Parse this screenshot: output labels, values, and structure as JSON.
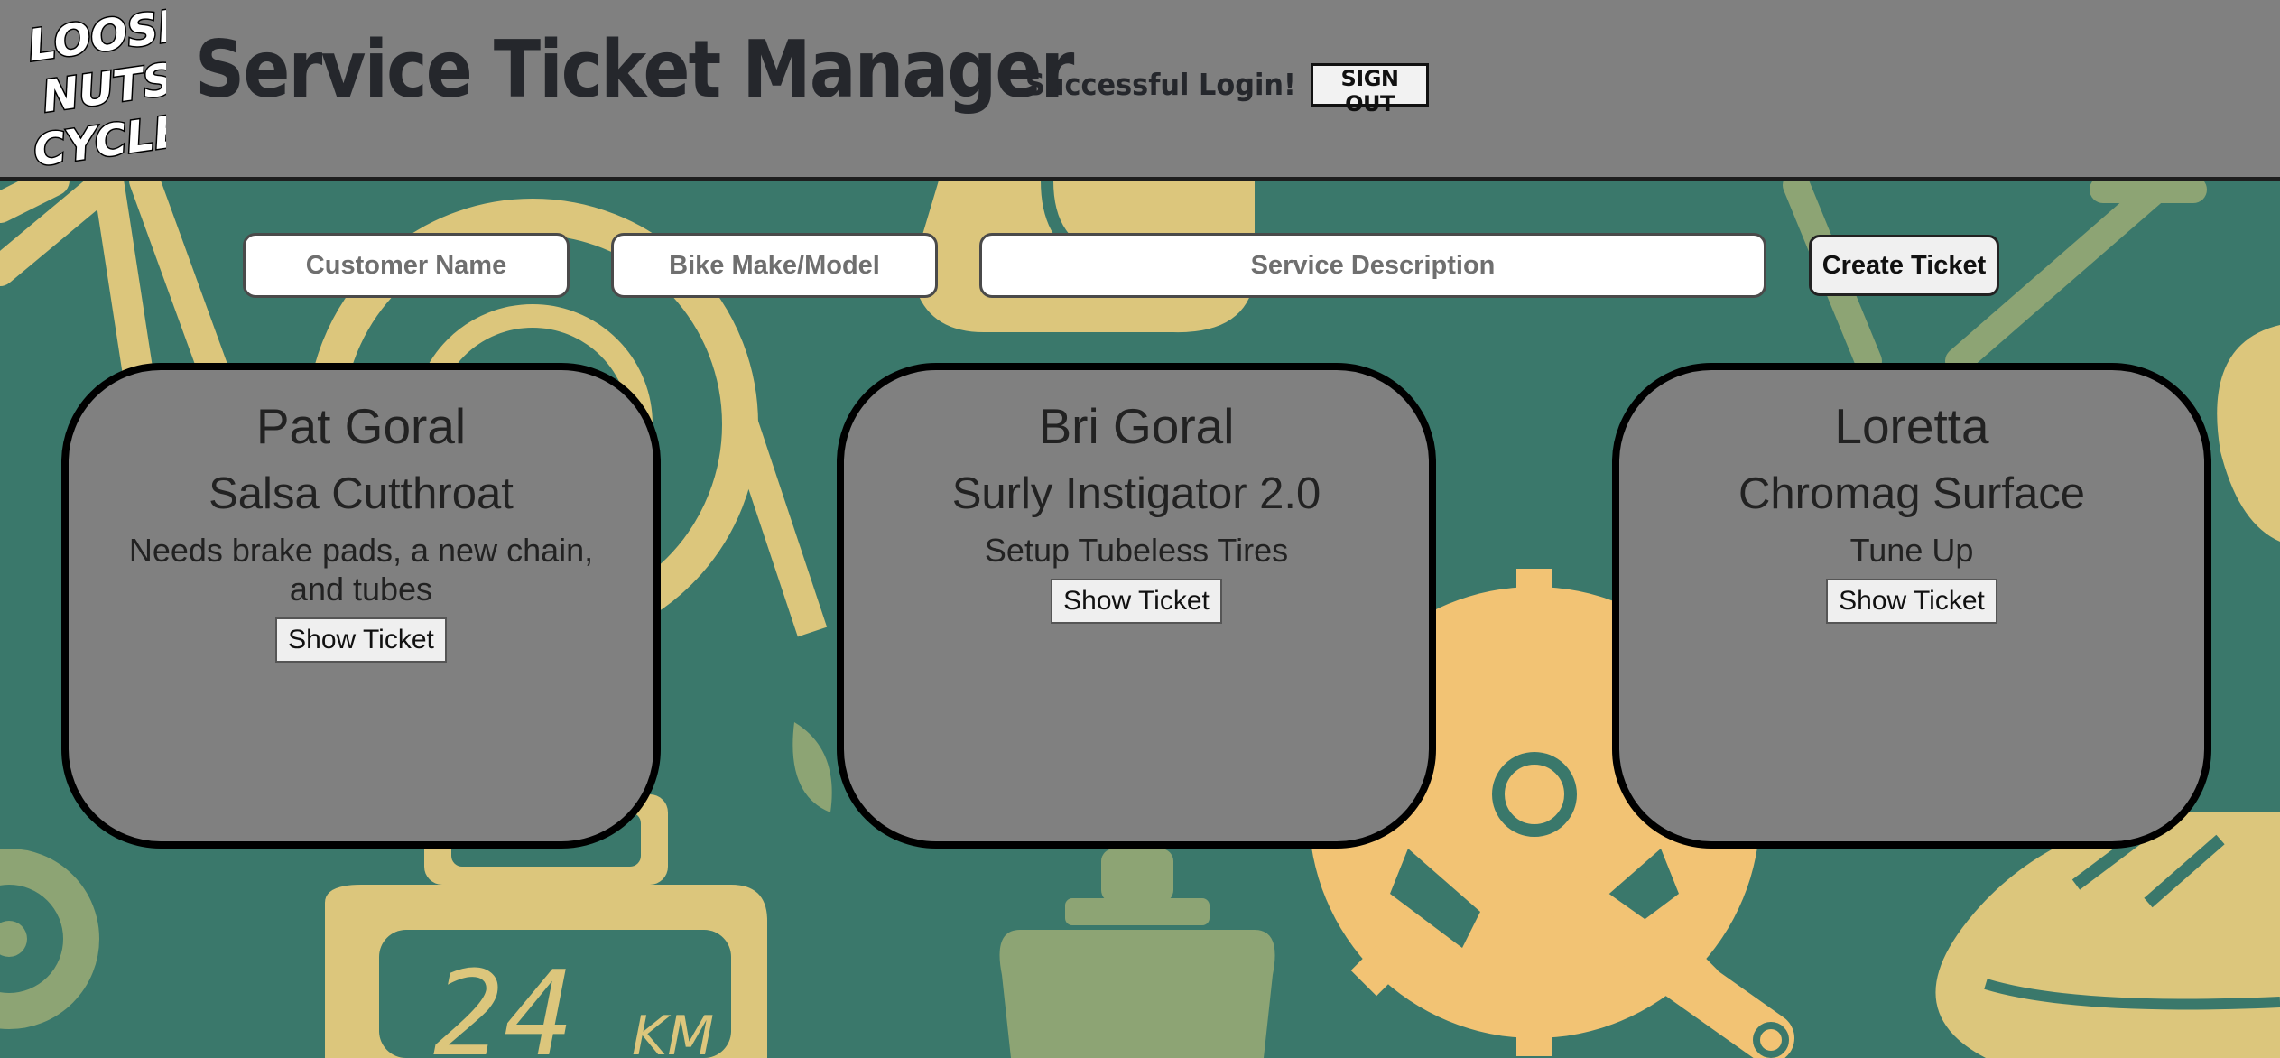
{
  "header": {
    "logo_lines": [
      "LOOSE",
      "NUTS",
      "CYCLES"
    ],
    "title": "Service Ticket Manager",
    "login_status": "Successful Login!",
    "sign_out_label": "SIGN OUT"
  },
  "form": {
    "customer_name_placeholder": "Customer Name",
    "bike_placeholder": "Bike Make/Model",
    "description_placeholder": "Service Description",
    "create_label": "Create Ticket"
  },
  "tickets": [
    {
      "customer": "Pat Goral",
      "bike": "Salsa Cutthroat",
      "description": "Needs brake pads, a new chain, and tubes",
      "button": "Show Ticket"
    },
    {
      "customer": "Bri Goral",
      "bike": "Surly Instigator 2.0",
      "description": "Setup Tubeless Tires",
      "button": "Show Ticket"
    },
    {
      "customer": "Loretta",
      "bike": "Chromag Surface",
      "description": "Tune Up",
      "button": "Show Ticket"
    }
  ],
  "background": {
    "base_color": "#3a786b",
    "art_color": "#dcc67c",
    "sage_color": "#8da474",
    "gear_color": "#f2c374",
    "odometer_text": "24",
    "odometer_unit": "KM"
  }
}
